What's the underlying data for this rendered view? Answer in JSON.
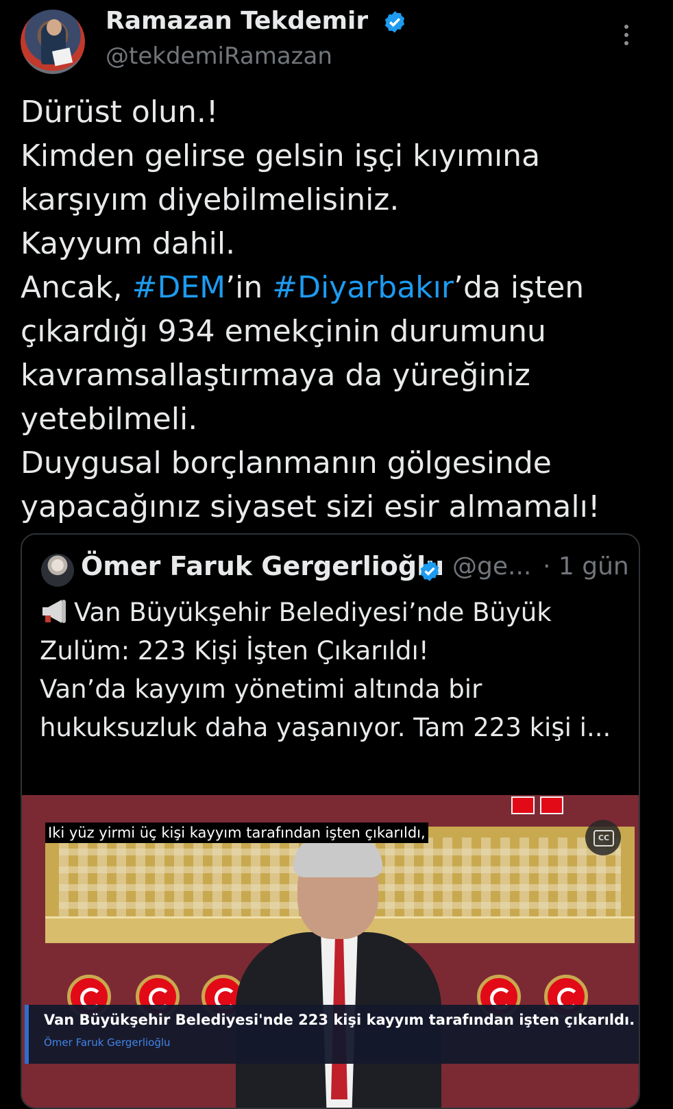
{
  "author": {
    "name": "Ramazan Tekdemir",
    "handle": "@tekdemiRamazan"
  },
  "tweet": {
    "parts": [
      "Dürüst olun.!\nKimden gelirse gelsin işçi kıyımına karşıyım diyebilmelisiniz.\nKayyum dahil.\nAncak, ",
      "#DEM",
      "’in ",
      "#Diyarbakır",
      "’da işten çıkardığı 934 emekçinin durumunu kavramsallaştırmaya da yüreğiniz yetebilmeli.\nDuygusal borçlanmanın gölgesinde yapacağınız siyaset sizi esir almamalı!"
    ]
  },
  "quoted": {
    "name": "Ömer Faruk Gergerlioğlu",
    "handle": "@ge...",
    "time": "· 1 gün",
    "text_line1": "Van Büyükşehir Belediyesi’nde Büyük\nZulüm: 223 Kişi İşten Çıkarıldı!",
    "text_line2": "\nVan’da kayyım yönetimi altında bir\nhukuksuzluk daha yaşanıyor. Tam 223 kişi i..."
  },
  "video": {
    "subtitle": "Iki yüz yirmi üç kişi kayyım tarafından işten çıkarıldı,",
    "cc_label": "CC",
    "lower_third_title": "Van Büyükşehir Belediyesi'nde 223 kişi kayyım tarafından işten çıkarıldı.",
    "lower_third_name": "Ömer Faruk Gergerlioğlu"
  },
  "colors": {
    "verified": "#1d9bf0",
    "hashtag": "#1d9bf0",
    "background": "#000000"
  },
  "icons": [
    "verified-badge-icon",
    "more-options-icon",
    "megaphone-icon",
    "cc-icon"
  ]
}
